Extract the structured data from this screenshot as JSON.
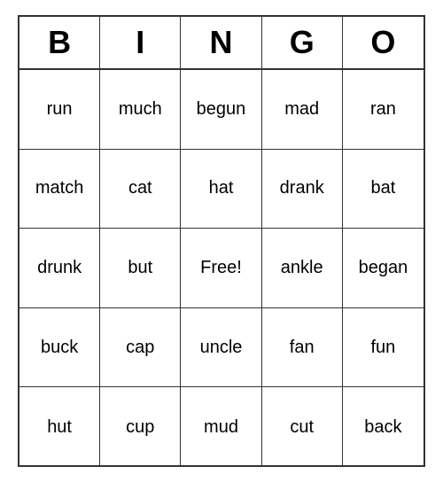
{
  "header": {
    "letters": [
      "B",
      "I",
      "N",
      "G",
      "O"
    ]
  },
  "grid": {
    "cells": [
      "run",
      "much",
      "begun",
      "mad",
      "ran",
      "match",
      "cat",
      "hat",
      "drank",
      "bat",
      "drunk",
      "but",
      "Free!",
      "ankle",
      "began",
      "buck",
      "cap",
      "uncle",
      "fan",
      "fun",
      "hut",
      "cup",
      "mud",
      "cut",
      "back"
    ]
  }
}
